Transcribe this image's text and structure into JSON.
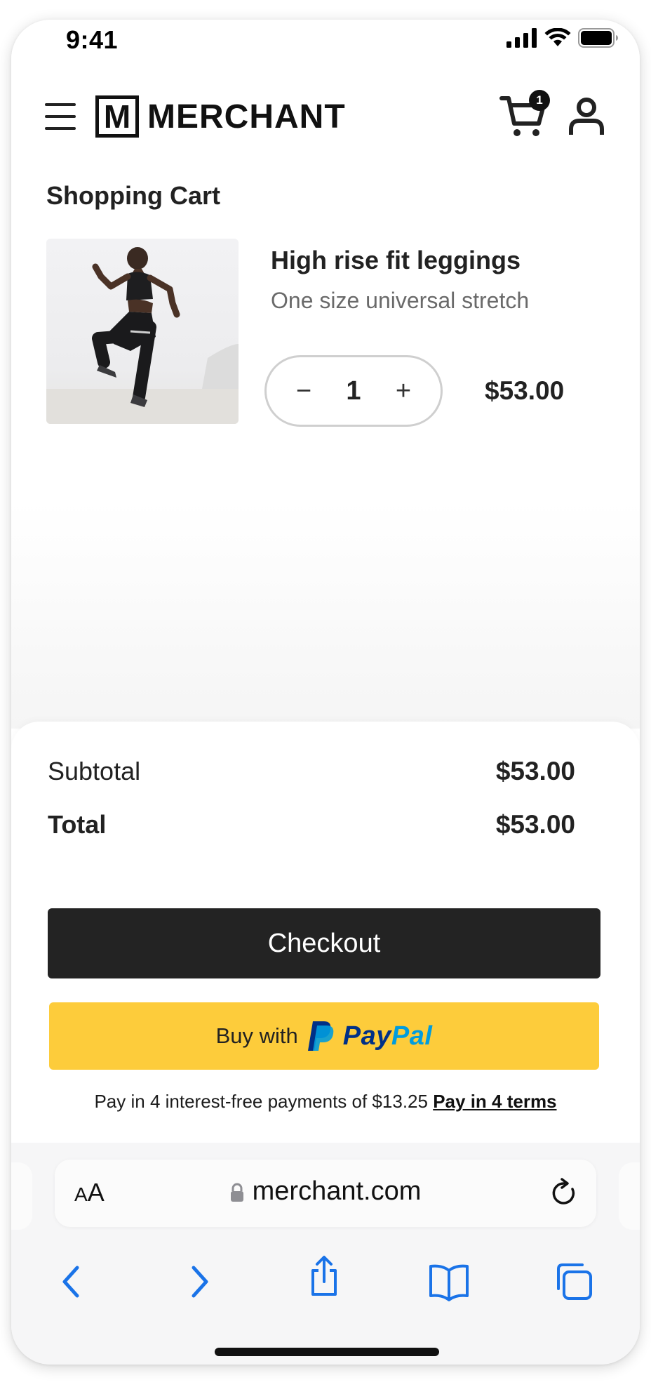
{
  "status_bar": {
    "time": "9:41"
  },
  "header": {
    "logo_letter": "M",
    "brand": "MERCHANT",
    "cart_count": "1"
  },
  "cart": {
    "title": "Shopping Cart",
    "item": {
      "name": "High rise fit leggings",
      "variant": "One size universal stretch",
      "quantity": "1",
      "price": "$53.00",
      "minus": "−",
      "plus": "+"
    }
  },
  "summary": {
    "subtotal_label": "Subtotal",
    "subtotal_value": "$53.00",
    "total_label": "Total",
    "total_value": "$53.00"
  },
  "actions": {
    "checkout": "Checkout",
    "paypal_prefix": "Buy with",
    "paypal_pay": "Pay",
    "paypal_pal": "Pal",
    "pay_later_text": "Pay in 4 interest-free payments of $13.25",
    "pay_later_link": "Pay in 4 terms"
  },
  "browser": {
    "aa_small": "A",
    "aa_big": "A",
    "url": "merchant.com"
  },
  "colors": {
    "checkout_bg": "#232323",
    "paypal_yellow": "#fdcc3b",
    "paypal_dark_blue": "#003087",
    "paypal_light_blue": "#009cde",
    "safari_blue": "#1a73e8"
  },
  "icons": {
    "menu": "hamburger-menu-icon",
    "cart": "shopping-cart-icon",
    "account": "user-icon",
    "lock": "lock-icon",
    "reload": "reload-icon",
    "back": "chevron-left-icon",
    "forward": "chevron-right-icon",
    "share": "share-icon",
    "bookmarks": "book-icon",
    "tabs": "tabs-icon"
  }
}
